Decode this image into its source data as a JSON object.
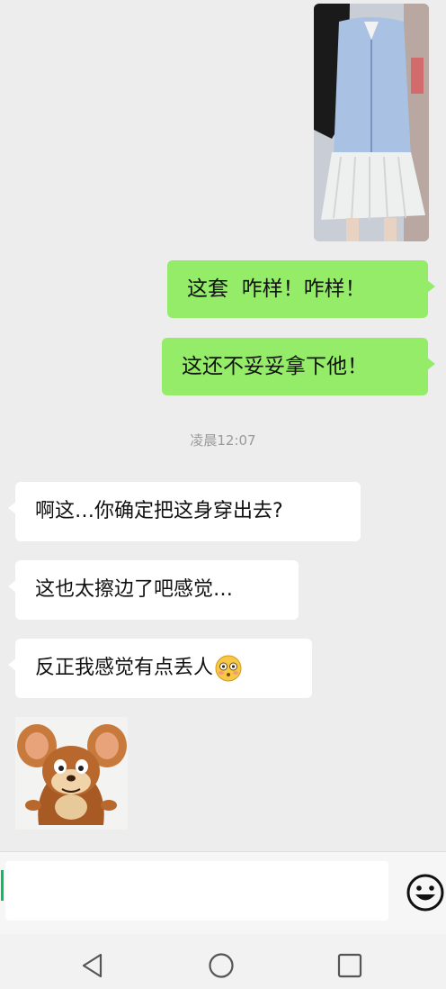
{
  "chat": {
    "sent_messages": [
      "这套  咋样！咋样！",
      "这还不妥妥拿下他！"
    ],
    "timestamp": "凌晨12:07",
    "received_messages": [
      "啊这…你确定把这身穿出去?",
      "这也太擦边了吧感觉…",
      "反正我感觉有点丢人"
    ],
    "emoji_in_last_message": "flushed-face-emoji",
    "sticker": "jerry-mouse-sticker"
  },
  "input": {
    "value": "",
    "emoji_icon": "smiley-face-icon"
  },
  "nav": {
    "back_icon": "back-triangle-icon",
    "home_icon": "home-circle-icon",
    "recents_icon": "recents-square-icon"
  },
  "colors": {
    "sent_bubble": "#95ec69",
    "received_bubble": "#ffffff",
    "background": "#ededed",
    "cursor": "#07c160"
  }
}
